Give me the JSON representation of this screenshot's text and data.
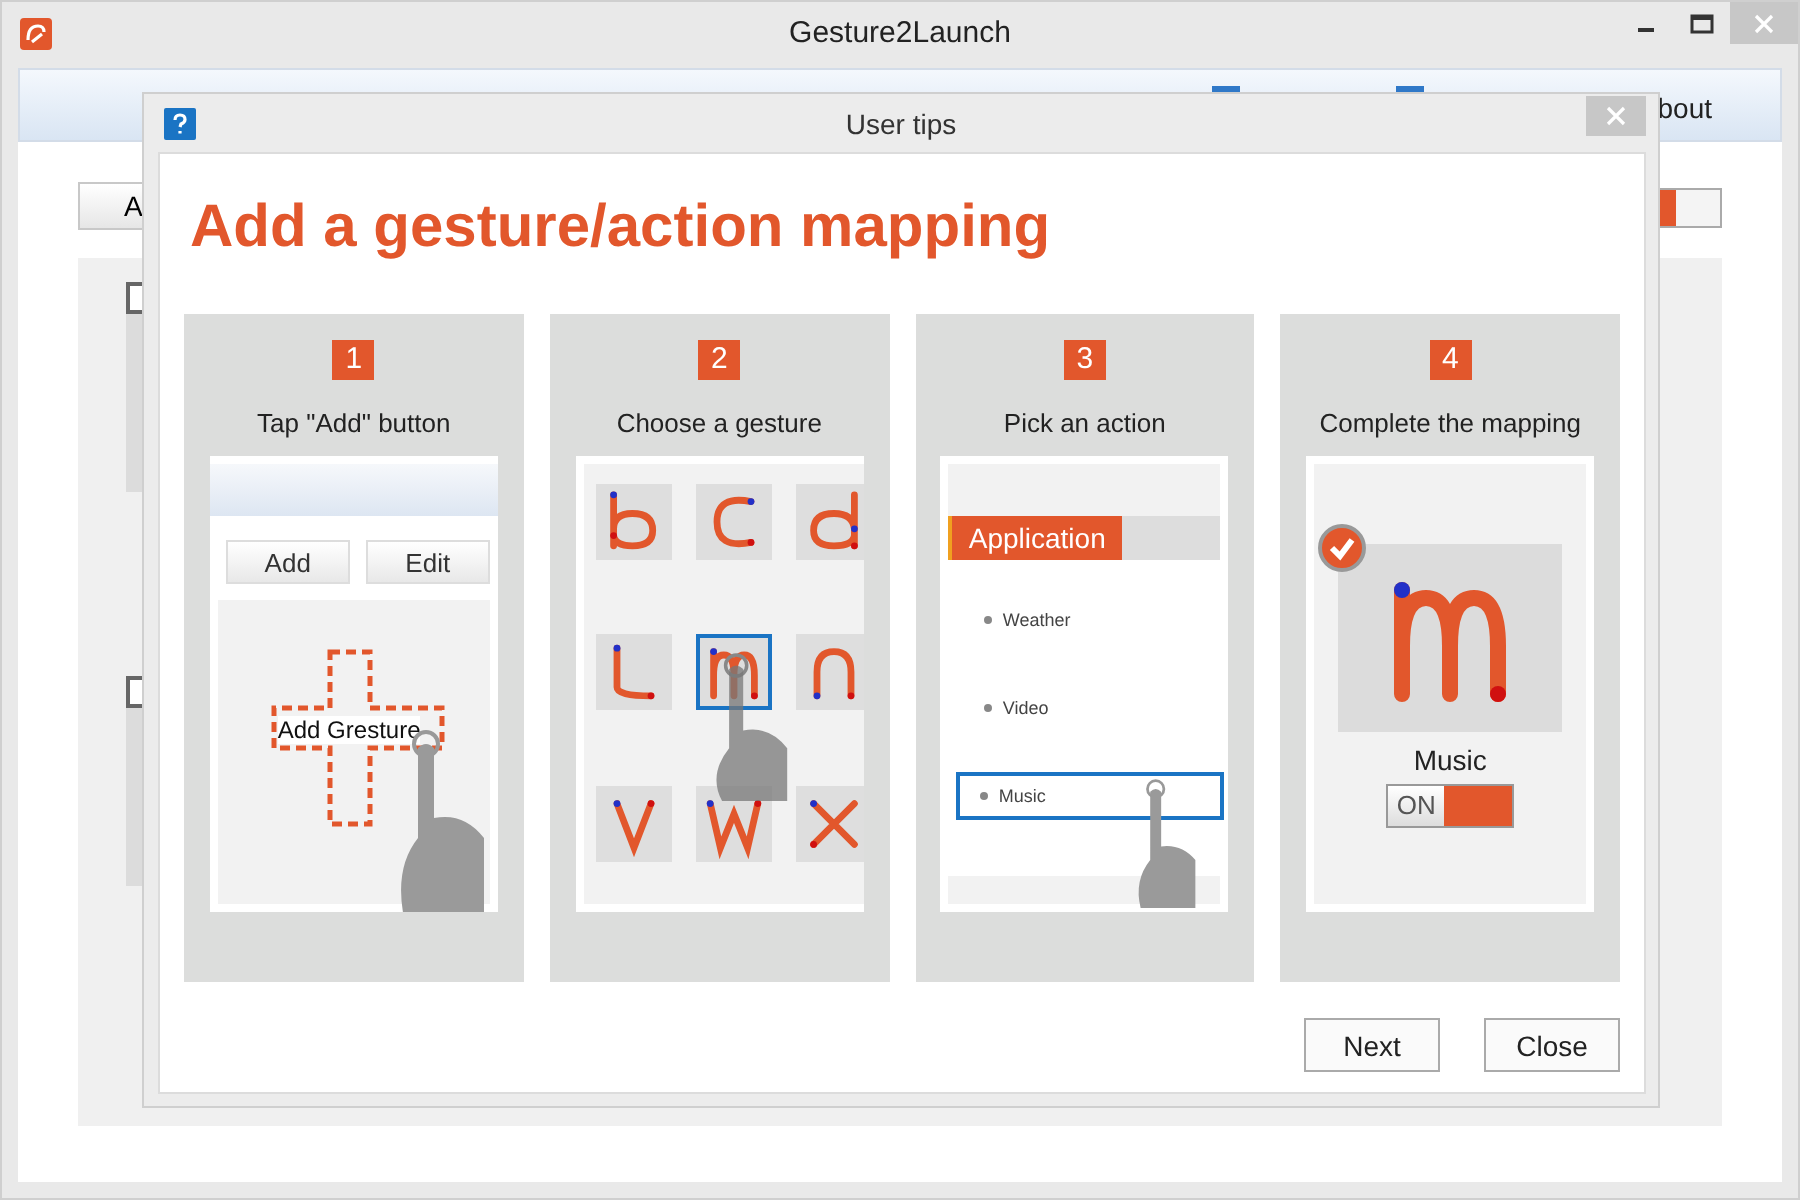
{
  "window": {
    "title": "Gesture2Launch"
  },
  "background": {
    "toolbar_text": "bout",
    "add_button": "A",
    "list_rows": [
      {
        "checked": false
      },
      {
        "checked": false
      }
    ],
    "switch": {
      "on": true
    }
  },
  "dialog": {
    "title": "User tips",
    "heading": "Add a gesture/action mapping",
    "steps": [
      {
        "kind": "tap_add",
        "number": "1",
        "caption": "Tap \"Add\" button",
        "buttons": [
          "Add",
          "Edit"
        ],
        "target": "Add Gresture"
      },
      {
        "kind": "choose_gesture",
        "number": "2",
        "caption": "Choose a gesture",
        "gestures": [
          {
            "kind": "b",
            "selected": false
          },
          {
            "kind": "c",
            "selected": false
          },
          {
            "kind": "d",
            "selected": false
          },
          {
            "kind": "l",
            "selected": false
          },
          {
            "kind": "m",
            "selected": true
          },
          {
            "kind": "n",
            "selected": false
          },
          {
            "kind": "v",
            "selected": false
          },
          {
            "kind": "w",
            "selected": false
          },
          {
            "kind": "x",
            "selected": false
          }
        ]
      },
      {
        "kind": "pick_action",
        "number": "3",
        "caption": "Pick an action",
        "tab": "Application",
        "items": [
          {
            "label": "Weather",
            "selected": false
          },
          {
            "label": "Video",
            "selected": false
          },
          {
            "label": "Music",
            "selected": true
          }
        ]
      },
      {
        "kind": "complete",
        "number": "4",
        "caption": "Complete the mapping",
        "gesture": {
          "kind": "m"
        },
        "checked": true,
        "label": "Music",
        "toggle": {
          "label": "ON",
          "on": true
        }
      }
    ],
    "buttons": [
      "Next",
      "Close"
    ]
  }
}
